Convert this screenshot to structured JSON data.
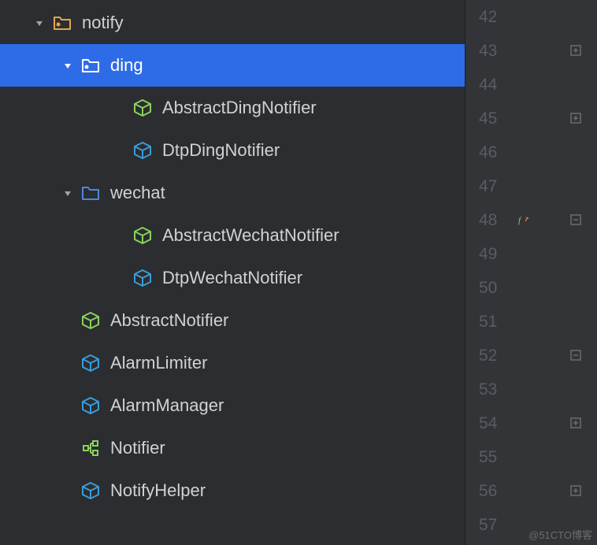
{
  "tree": [
    {
      "indent": 0,
      "expanded": true,
      "icon": "package-folder",
      "label": "notify",
      "selected": false
    },
    {
      "indent": 1,
      "expanded": true,
      "icon": "package-folder",
      "label": "ding",
      "selected": true
    },
    {
      "indent": 2,
      "expanded": null,
      "icon": "abstract-class",
      "label": "AbstractDingNotifier",
      "selected": false
    },
    {
      "indent": 2,
      "expanded": null,
      "icon": "class",
      "label": "DtpDingNotifier",
      "selected": false
    },
    {
      "indent": 1,
      "expanded": true,
      "icon": "folder",
      "label": "wechat",
      "selected": false
    },
    {
      "indent": 2,
      "expanded": null,
      "icon": "abstract-class",
      "label": "AbstractWechatNotifier",
      "selected": false
    },
    {
      "indent": 2,
      "expanded": null,
      "icon": "class",
      "label": "DtpWechatNotifier",
      "selected": false
    },
    {
      "indent": 1,
      "expanded": null,
      "icon": "abstract-class",
      "label": "AbstractNotifier",
      "selected": false
    },
    {
      "indent": 1,
      "expanded": null,
      "icon": "class",
      "label": "AlarmLimiter",
      "selected": false
    },
    {
      "indent": 1,
      "expanded": null,
      "icon": "class",
      "label": "AlarmManager",
      "selected": false
    },
    {
      "indent": 1,
      "expanded": null,
      "icon": "interface",
      "label": "Notifier",
      "selected": false
    },
    {
      "indent": 1,
      "expanded": null,
      "icon": "class",
      "label": "NotifyHelper",
      "selected": false
    }
  ],
  "gutter": {
    "start": 42,
    "end": 57,
    "markers": [
      {
        "line": 43,
        "type": "collapse"
      },
      {
        "line": 45,
        "type": "collapse"
      },
      {
        "line": 48,
        "type": "fx"
      },
      {
        "line": 48,
        "type": "collapse-end"
      },
      {
        "line": 52,
        "type": "collapse-end"
      },
      {
        "line": 54,
        "type": "collapse"
      },
      {
        "line": 56,
        "type": "collapse"
      }
    ]
  },
  "watermark": "@51CTO博客"
}
